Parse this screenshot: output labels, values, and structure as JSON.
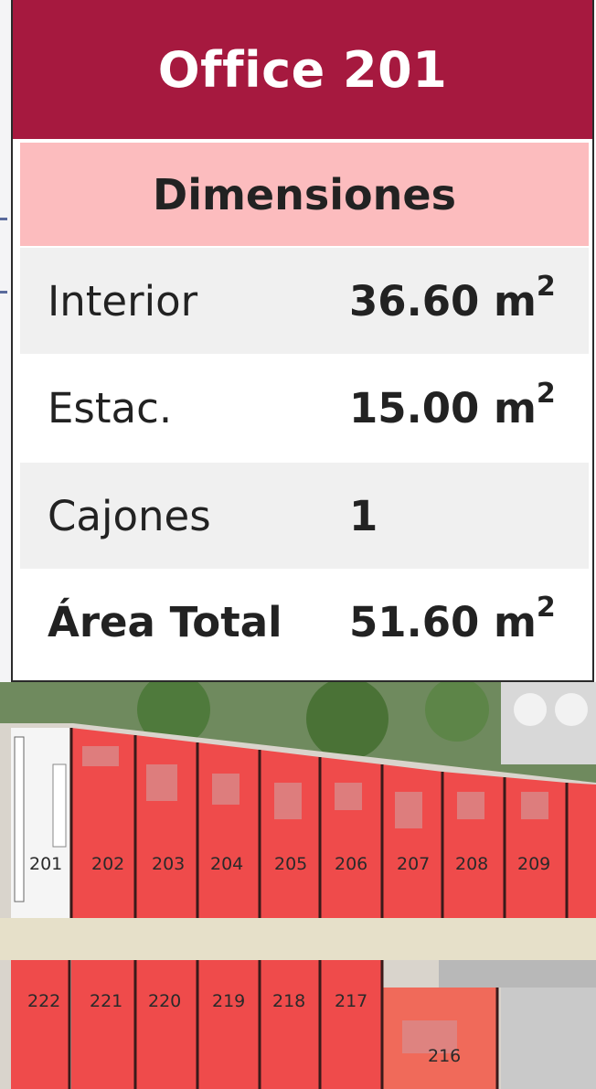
{
  "card": {
    "title": "Office 201",
    "section_title": "Dimensiones",
    "rows": [
      {
        "label": "Interior",
        "value": "36.60 m",
        "sup": "2"
      },
      {
        "label": "Estac.",
        "value": "15.00 m",
        "sup": "2"
      },
      {
        "label": "Cajones",
        "value": "1",
        "sup": ""
      },
      {
        "label": "Área Total",
        "value": "51.60 m",
        "sup": "2"
      }
    ]
  },
  "colors": {
    "header": "#a6193f",
    "section": "#fcbcbe",
    "unit_highlight": "#ef3b3b"
  },
  "floor_plan": {
    "top_units": [
      "201",
      "202",
      "203",
      "204",
      "205",
      "206",
      "207",
      "208",
      "209"
    ],
    "bottom_units": [
      "222",
      "221",
      "220",
      "219",
      "218",
      "217",
      "216"
    ]
  }
}
